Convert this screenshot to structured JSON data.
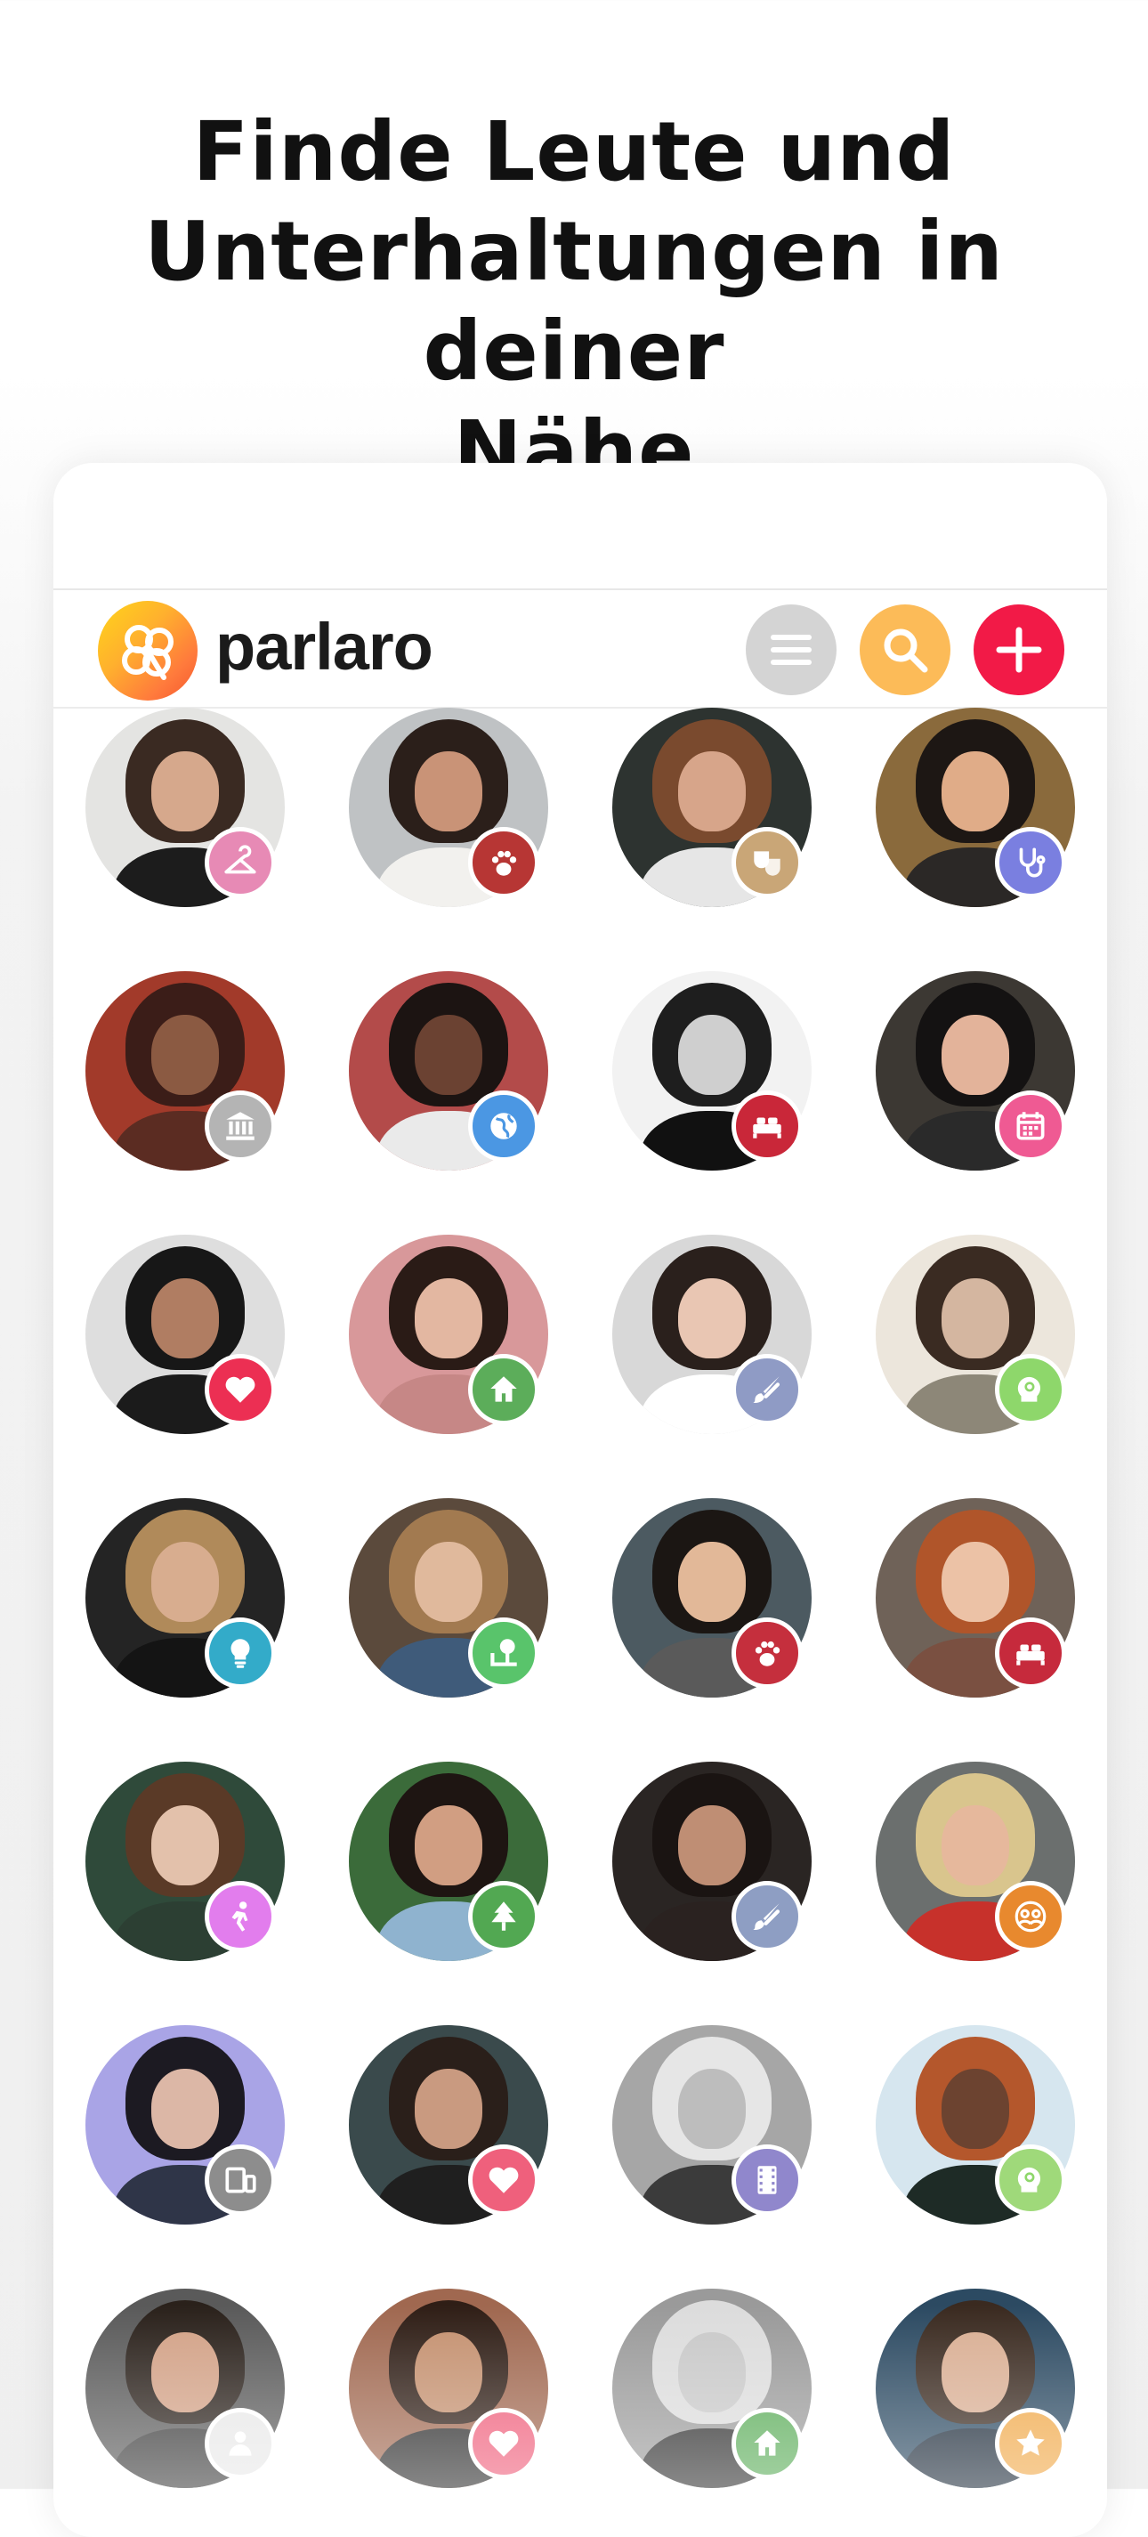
{
  "headline": [
    "Finde Leute und",
    "Unterhaltungen in deiner",
    "Nähe"
  ],
  "app": {
    "brand": "parlaro",
    "colors": {
      "menu": "#d4d4d4",
      "search": "#fcbb58",
      "add": "#f21a47"
    }
  },
  "profiles": [
    {
      "bg": "#e4e4e2",
      "hair": "#3a2a22",
      "skin": "#d6a88c",
      "shirt": "#1c1c1c",
      "badge": "#e78ab5",
      "icon": "hanger-icon"
    },
    {
      "bg": "#bfc2c4",
      "hair": "#2b1f1a",
      "skin": "#c99377",
      "shirt": "#f2f1ee",
      "badge": "#b73634",
      "icon": "paw-icon"
    },
    {
      "bg": "#2d3330",
      "hair": "#7a4a2e",
      "skin": "#d7a58a",
      "shirt": "#e6e6e6",
      "badge": "#c9a677",
      "icon": "theater-masks-icon"
    },
    {
      "bg": "#8a6a3c",
      "hair": "#1d1714",
      "skin": "#e0ac88",
      "shirt": "#2b2826",
      "badge": "#7a7fe0",
      "icon": "stethoscope-icon"
    },
    {
      "bg": "#a23a2a",
      "hair": "#3b1d18",
      "skin": "#8b5a42",
      "shirt": "#5b2c22",
      "badge": "#b4b4b4",
      "icon": "museum-icon"
    },
    {
      "bg": "#b34b4a",
      "hair": "#1c1412",
      "skin": "#6b4232",
      "shirt": "#eaeaea",
      "badge": "#4b97e3",
      "icon": "globe-icon"
    },
    {
      "bg": "#f2f2f2",
      "hair": "#1e1e1e",
      "skin": "#cfcfcf",
      "shirt": "#111111",
      "badge": "#c92739",
      "icon": "bed-icon"
    },
    {
      "bg": "#3c3833",
      "hair": "#141212",
      "skin": "#e3b39a",
      "shirt": "#2a2a2a",
      "badge": "#ef5a93",
      "icon": "calendar-icon"
    },
    {
      "bg": "#dedede",
      "hair": "#171717",
      "skin": "#b07d62",
      "shirt": "#1b1b1b",
      "badge": "#ec2f53",
      "icon": "heart-icon"
    },
    {
      "bg": "#d8989a",
      "hair": "#2a1b16",
      "skin": "#e3b7a1",
      "shirt": "#c68786",
      "badge": "#5cad5a",
      "icon": "home-icon"
    },
    {
      "bg": "#d8d8d8",
      "hair": "#2a201c",
      "skin": "#e9c6b3",
      "shirt": "#ffffff",
      "badge": "#8f9bc5",
      "icon": "paintbrush-icon"
    },
    {
      "bg": "#ece6dc",
      "hair": "#3a2b22",
      "skin": "#d4b6a0",
      "shirt": "#8d8778",
      "badge": "#8ed76b",
      "icon": "mind-icon"
    },
    {
      "bg": "#242424",
      "hair": "#b08a5a",
      "skin": "#d8ad8f",
      "shirt": "#141414",
      "badge": "#33abc9",
      "icon": "lightbulb-icon"
    },
    {
      "bg": "#5b4a3c",
      "hair": "#a27a50",
      "skin": "#e0b99c",
      "shirt": "#3f5b7a",
      "badge": "#59c46b",
      "icon": "park-icon"
    },
    {
      "bg": "#4c5a61",
      "hair": "#1b1613",
      "skin": "#e2b898",
      "shirt": "#5a5a5a",
      "badge": "#c52f3d",
      "icon": "paw-icon"
    },
    {
      "bg": "#6f6258",
      "hair": "#b0552a",
      "skin": "#ecc2a6",
      "shirt": "#7a5041",
      "badge": "#c62a3c",
      "icon": "bed-icon"
    },
    {
      "bg": "#2f4a3a",
      "hair": "#5a3a27",
      "skin": "#e3c1ab",
      "shirt": "#2c3f33",
      "badge": "#e27ded",
      "icon": "dance-icon"
    },
    {
      "bg": "#3b6b3a",
      "hair": "#1e1512",
      "skin": "#d19e82",
      "shirt": "#8fb3cf",
      "badge": "#52a852",
      "icon": "tree-icon"
    },
    {
      "bg": "#2a2523",
      "hair": "#1a1412",
      "skin": "#bf8e74",
      "shirt": "#2a2220",
      "badge": "#8e9ec3",
      "icon": "paintbrush-icon"
    },
    {
      "bg": "#6b6f6e",
      "hair": "#d9c58d",
      "skin": "#e6b89c",
      "shirt": "#c7312b",
      "badge": "#e8892e",
      "icon": "community-icon"
    },
    {
      "bg": "#a9a4e6",
      "hair": "#1c1a22",
      "skin": "#dcb7a6",
      "shirt": "#2f3548",
      "badge": "#8d8d8d",
      "icon": "devices-icon"
    },
    {
      "bg": "#3a4a4c",
      "hair": "#2a1f1a",
      "skin": "#c99a80",
      "shirt": "#1f1f1f",
      "badge": "#ef607c",
      "icon": "heart-icon"
    },
    {
      "bg": "#a6a6a6",
      "hair": "#e6e6e6",
      "skin": "#bdbdbd",
      "shirt": "#3b3b3b",
      "badge": "#9087cc",
      "icon": "film-icon"
    },
    {
      "bg": "#d6e6ef",
      "hair": "#b4572c",
      "skin": "#6c4330",
      "shirt": "#1e2b26",
      "badge": "#9fd97a",
      "icon": "mind-icon"
    },
    {
      "bg": "#5a5a5a",
      "hair": "#2a211b",
      "skin": "#d2a186",
      "shirt": "#3b3b3b",
      "badge": "#e8e8e8",
      "icon": "person-icon"
    },
    {
      "bg": "#a06850",
      "hair": "#2f1e16",
      "skin": "#c4906f",
      "shirt": "#2a2a2a",
      "badge": "#ef607c",
      "icon": "heart-icon"
    },
    {
      "bg": "#9a9a9a",
      "hair": "#dcdcdc",
      "skin": "#c8c8c8",
      "shirt": "#2e2e2e",
      "badge": "#5cad5a",
      "icon": "home-icon"
    },
    {
      "bg": "#2c4a62",
      "hair": "#3a2a20",
      "skin": "#d9ae93",
      "shirt": "#1d2b3a",
      "badge": "#f0a94a",
      "icon": "star-icon"
    }
  ]
}
